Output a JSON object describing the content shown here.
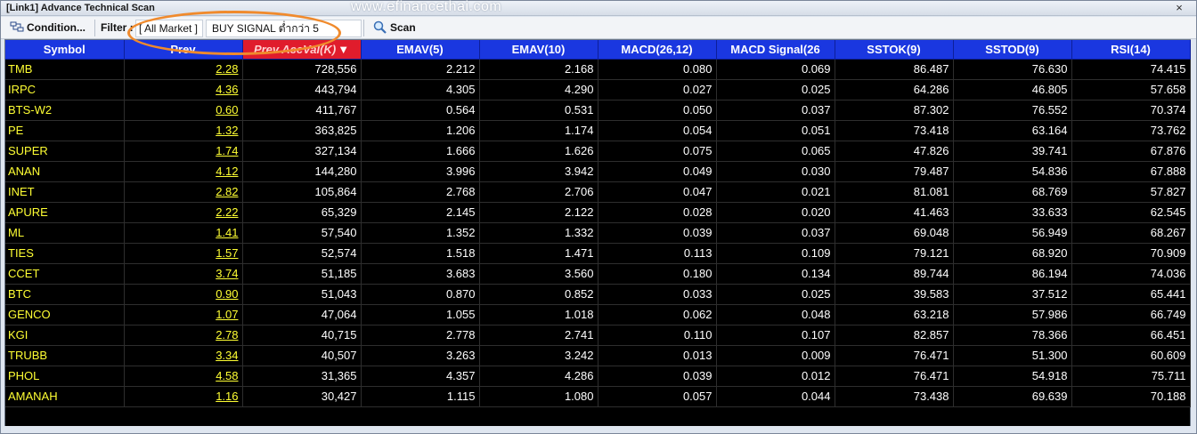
{
  "window": {
    "title": "[Link1] Advance Technical Scan",
    "watermark": "www.efinancethai.com",
    "close_glyph": "×"
  },
  "toolbar": {
    "condition_label": "Condition...",
    "filter_label": "Filter :",
    "market_value": "[ All Market ]",
    "signal_value": "BUY SIGNAL ต่ำกว่า 5",
    "scan_label": "Scan",
    "condition_icon": "condition-icon",
    "scan_icon": "magnifier-icon"
  },
  "colors": {
    "header_bg": "#1a37e0",
    "sorted_header_bg": "#e01c2c",
    "grid_bg": "#000000",
    "symbol_text": "#ffff33",
    "highlight_ring": "#f08a2c"
  },
  "table": {
    "columns": [
      "Symbol",
      "Prev",
      "Prev AccVal(K)",
      "EMAV(5)",
      "EMAV(10)",
      "MACD(26,12)",
      "MACD Signal(26",
      "SSTOK(9)",
      "SSTOD(9)",
      "RSI(14)"
    ],
    "sort_arrow": "▼",
    "rows": [
      [
        "TMB",
        "2.28",
        "728,556",
        "2.212",
        "2.168",
        "0.080",
        "0.069",
        "86.487",
        "76.630",
        "74.415"
      ],
      [
        "IRPC",
        "4.36",
        "443,794",
        "4.305",
        "4.290",
        "0.027",
        "0.025",
        "64.286",
        "46.805",
        "57.658"
      ],
      [
        "BTS-W2",
        "0.60",
        "411,767",
        "0.564",
        "0.531",
        "0.050",
        "0.037",
        "87.302",
        "76.552",
        "70.374"
      ],
      [
        "PE",
        "1.32",
        "363,825",
        "1.206",
        "1.174",
        "0.054",
        "0.051",
        "73.418",
        "63.164",
        "73.762"
      ],
      [
        "SUPER",
        "1.74",
        "327,134",
        "1.666",
        "1.626",
        "0.075",
        "0.065",
        "47.826",
        "39.741",
        "67.876"
      ],
      [
        "ANAN",
        "4.12",
        "144,280",
        "3.996",
        "3.942",
        "0.049",
        "0.030",
        "79.487",
        "54.836",
        "67.888"
      ],
      [
        "INET",
        "2.82",
        "105,864",
        "2.768",
        "2.706",
        "0.047",
        "0.021",
        "81.081",
        "68.769",
        "57.827"
      ],
      [
        "APURE",
        "2.22",
        "65,329",
        "2.145",
        "2.122",
        "0.028",
        "0.020",
        "41.463",
        "33.633",
        "62.545"
      ],
      [
        "ML",
        "1.41",
        "57,540",
        "1.352",
        "1.332",
        "0.039",
        "0.037",
        "69.048",
        "56.949",
        "68.267"
      ],
      [
        "TIES",
        "1.57",
        "52,574",
        "1.518",
        "1.471",
        "0.113",
        "0.109",
        "79.121",
        "68.920",
        "70.909"
      ],
      [
        "CCET",
        "3.74",
        "51,185",
        "3.683",
        "3.560",
        "0.180",
        "0.134",
        "89.744",
        "86.194",
        "74.036"
      ],
      [
        "BTC",
        "0.90",
        "51,043",
        "0.870",
        "0.852",
        "0.033",
        "0.025",
        "39.583",
        "37.512",
        "65.441"
      ],
      [
        "GENCO",
        "1.07",
        "47,064",
        "1.055",
        "1.018",
        "0.062",
        "0.048",
        "63.218",
        "57.986",
        "66.749"
      ],
      [
        "KGI",
        "2.78",
        "40,715",
        "2.778",
        "2.741",
        "0.110",
        "0.107",
        "82.857",
        "78.366",
        "66.451"
      ],
      [
        "TRUBB",
        "3.34",
        "40,507",
        "3.263",
        "3.242",
        "0.013",
        "0.009",
        "76.471",
        "51.300",
        "60.609"
      ],
      [
        "PHOL",
        "4.58",
        "31,365",
        "4.357",
        "4.286",
        "0.039",
        "0.012",
        "76.471",
        "54.918",
        "75.711"
      ],
      [
        "AMANAH",
        "1.16",
        "30,427",
        "1.115",
        "1.080",
        "0.057",
        "0.044",
        "73.438",
        "69.639",
        "70.188"
      ]
    ]
  }
}
